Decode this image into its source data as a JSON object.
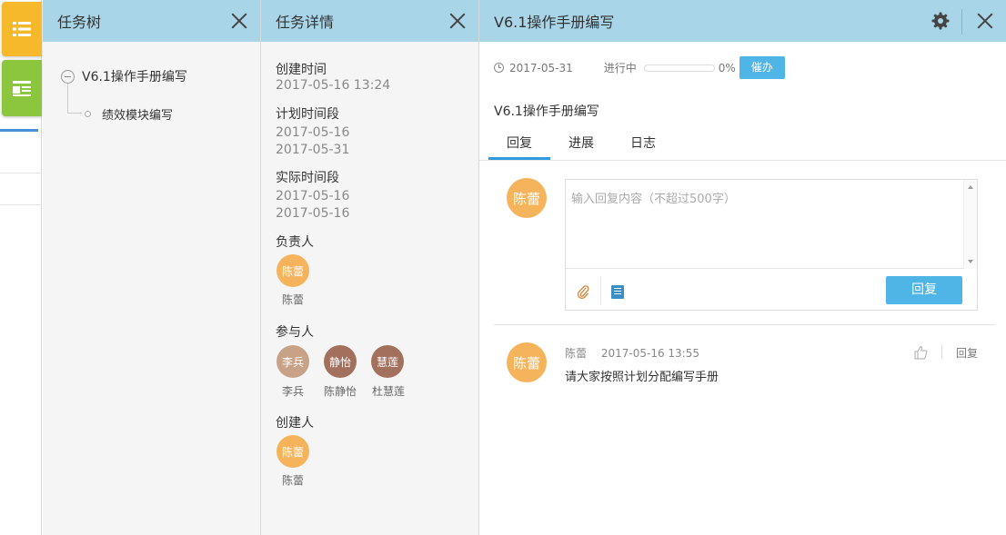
{
  "colors": {
    "header_bg": "#a8d5e8",
    "accent": "#4fb4e6",
    "tree_button": "#f6b92b",
    "detail_button": "#8cc63f",
    "avatar_orange": "#f5b45c",
    "avatar_taupe": "#c8a287",
    "avatar_brown": "#a3705e"
  },
  "sidebar": {
    "tree_icon": "list-icon",
    "detail_icon": "detail-icon"
  },
  "tree_panel": {
    "title": "任务树",
    "root": "V6.1操作手册编写",
    "child": "绩效模块编写"
  },
  "detail_panel": {
    "title": "任务详情",
    "created_label": "创建时间",
    "created_value": "2017-05-16 13:24",
    "plan_label": "计划时间段",
    "plan_start": "2017-05-16",
    "plan_end": "2017-05-31",
    "actual_label": "实际时间段",
    "actual_start": "2017-05-16",
    "actual_end": "2017-05-16",
    "owner_label": "负责人",
    "owner": {
      "avatar": "陈蕾",
      "name": "陈蕾"
    },
    "participants_label": "参与人",
    "participants": [
      {
        "avatar": "李兵",
        "name": "李兵"
      },
      {
        "avatar": "静怡",
        "name": "陈静怡"
      },
      {
        "avatar": "慧莲",
        "name": "杜慧莲"
      }
    ],
    "creator_label": "创建人",
    "creator": {
      "avatar": "陈蕾",
      "name": "陈蕾"
    }
  },
  "main_panel": {
    "title": "V6.1操作手册编写",
    "due_date": "2017-05-31",
    "status": "进行中",
    "progress_value": 0,
    "progress_text": "0%",
    "urge_button": "催办",
    "task_name": "V6.1操作手册编写",
    "tabs": [
      "回复",
      "进展",
      "日志"
    ],
    "reply": {
      "avatar": "陈蕾",
      "placeholder": "输入回复内容（不超过500字）",
      "submit": "回复"
    },
    "comment": {
      "avatar": "陈蕾",
      "author": "陈蕾",
      "time": "2017-05-16 13:55",
      "text": "请大家按照计划分配编写手册",
      "reply_link": "回复"
    }
  }
}
